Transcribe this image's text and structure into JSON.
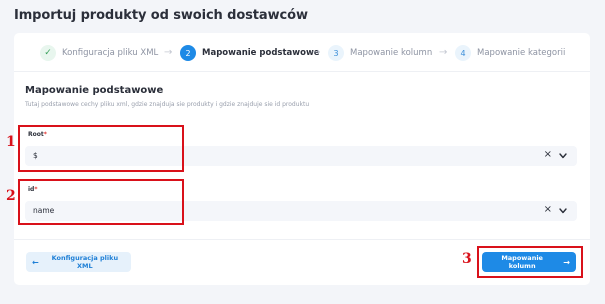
{
  "page": {
    "title": "Importuj produkty od swoich dostawców"
  },
  "stepper": {
    "steps": [
      {
        "number": "✓",
        "label": "Konfiguracja pliku XML",
        "state": "done"
      },
      {
        "number": "2",
        "label": "Mapowanie podstawowe",
        "state": "active"
      },
      {
        "number": "3",
        "label": "Mapowanie kolumn",
        "state": "pending"
      },
      {
        "number": "4",
        "label": "Mapowanie kategorii",
        "state": "pending"
      }
    ],
    "arrow": "→"
  },
  "section": {
    "title": "Mapowanie podstawowe",
    "description": "Tutaj podstawowe cechy pliku xml, gdzie znajduja sie produkty i gdzie znajduje sie id produktu"
  },
  "fields": {
    "root": {
      "label": "Root",
      "required_mark": "*",
      "value": "$"
    },
    "id": {
      "label": "id",
      "required_mark": "*",
      "value": "name"
    },
    "clear_glyph": "×"
  },
  "footer": {
    "back_label": "Konfiguracja pliku XML",
    "back_arrow": "←",
    "next_label": "Mapowanie kolumn",
    "next_arrow": "→"
  },
  "annotations": {
    "marker_1": "1",
    "marker_2": "2",
    "marker_3": "3"
  },
  "colors": {
    "accent": "#1e8ae6",
    "annotation_red": "#d9111a",
    "success": "#3aa15c"
  }
}
